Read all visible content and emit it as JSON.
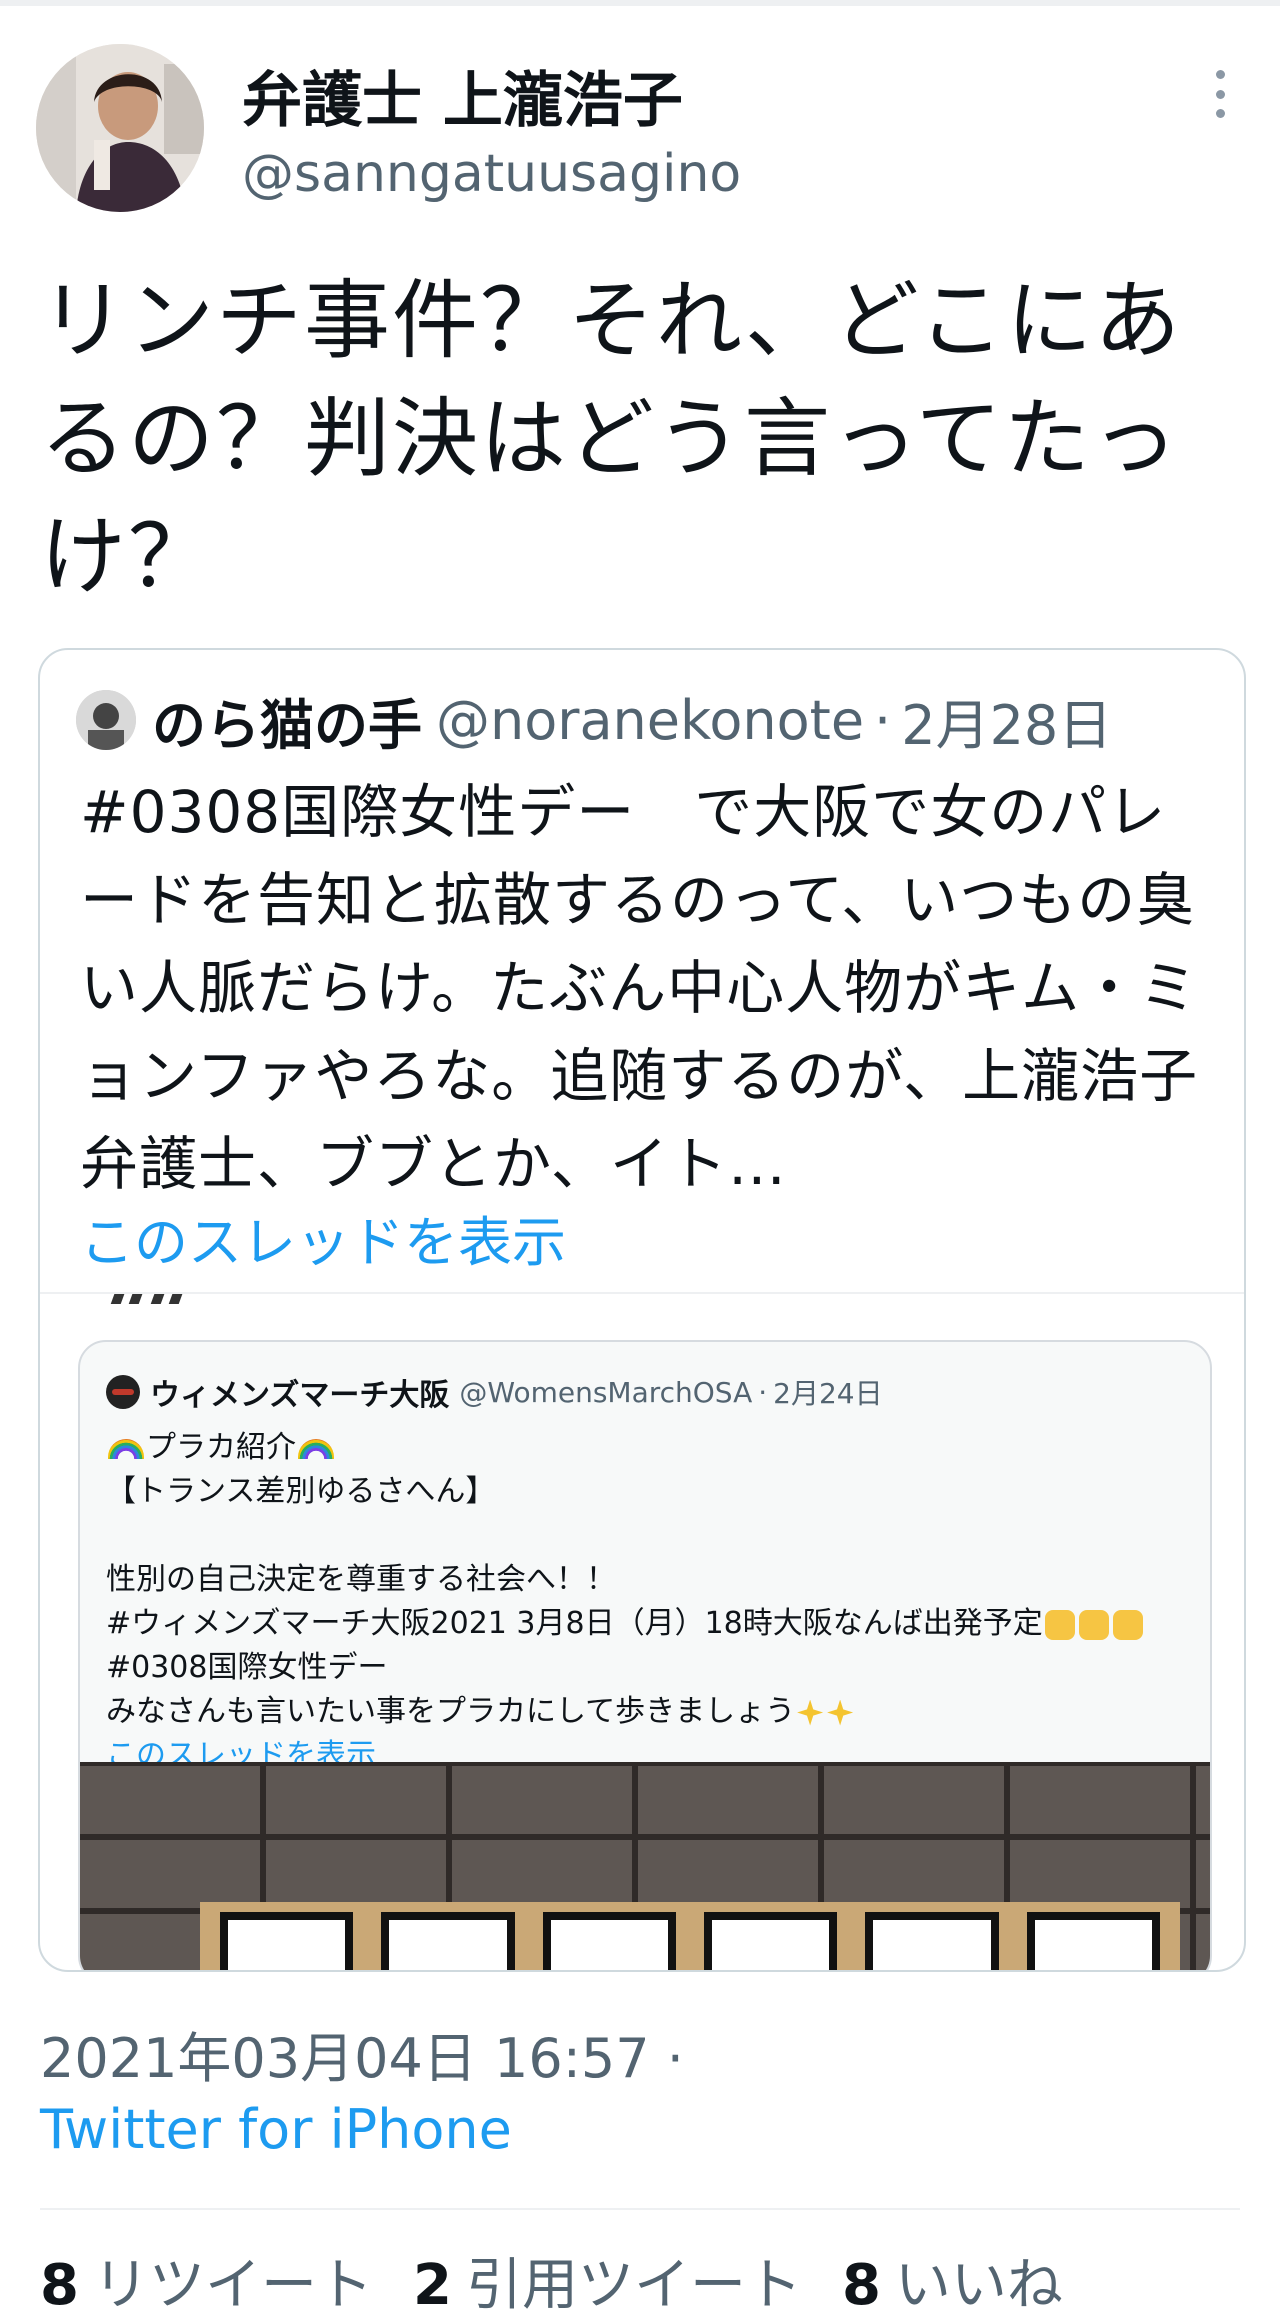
{
  "author": {
    "name": "弁護士 上瀧浩子",
    "handle": "@sanngatuusagino"
  },
  "tweet": {
    "text": "リンチ事件？それ、どこにあるの？判決はどう言ってたっけ？"
  },
  "quote": {
    "name": "のら猫の手",
    "handle": "@noranekonote",
    "separator": "·",
    "date": "2月28日",
    "text": "#0308国際女性デー　で大阪で女のパレードを告知と拡散するのって、いつもの臭い人脈だらけ。たぶん中心人物がキム・ミョンファやろな。追随するのが、上瀧浩子弁護士、ブブとか、イト…",
    "show_thread": "このスレッドを表示",
    "inner": {
      "name": "ウィメンズマーチ大阪",
      "handle": "@WomensMarchOSA",
      "separator": "·",
      "date": "2月24日",
      "line1": "プラカ紹介",
      "line2": "【トランス差別ゆるさへん】",
      "line3": "",
      "line4": "性別の自己決定を尊重する社会へ！！",
      "line5": "#ウィメンズマーチ大阪2021 3月8日（月）18時大阪なんば出発予定",
      "line6": " #0308国際女性デー",
      "line7": "みなさんも言いたい事をプラカにして歩きましょう",
      "show_thread": "このスレッドを表示"
    }
  },
  "meta": {
    "timestamp": "2021年03月04日 16:57 ·",
    "client": "Twitter for iPhone"
  },
  "stats": [
    {
      "count": "8",
      "label": "リツイート"
    },
    {
      "count": "2",
      "label": "引用ツイート"
    },
    {
      "count": "8",
      "label": "いいね"
    }
  ],
  "colors": {
    "link": "#1d9bf0",
    "secondary": "#536471",
    "border": "#cfd9de"
  }
}
